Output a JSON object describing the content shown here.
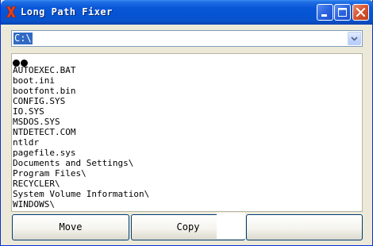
{
  "window": {
    "title": "Long Path Fixer",
    "icon": "red-x-icon"
  },
  "drive_select": {
    "value": "C:\\"
  },
  "file_list": {
    "items": [
      "AUTOEXEC.BAT",
      "boot.ini",
      "bootfont.bin",
      "CONFIG.SYS",
      "IO.SYS",
      "MSDOS.SYS",
      "NTDETECT.COM",
      "ntldr",
      "pagefile.sys",
      "Documents and Settings\\",
      "Program Files\\",
      "RECYCLER\\",
      "System Volume Information\\",
      "WINDOWS\\"
    ]
  },
  "buttons": {
    "move": "Move",
    "copy": "Copy"
  },
  "colors": {
    "title_bar": "#0454d4",
    "selection": "#316ac5",
    "window_bg": "#ece9d8"
  }
}
